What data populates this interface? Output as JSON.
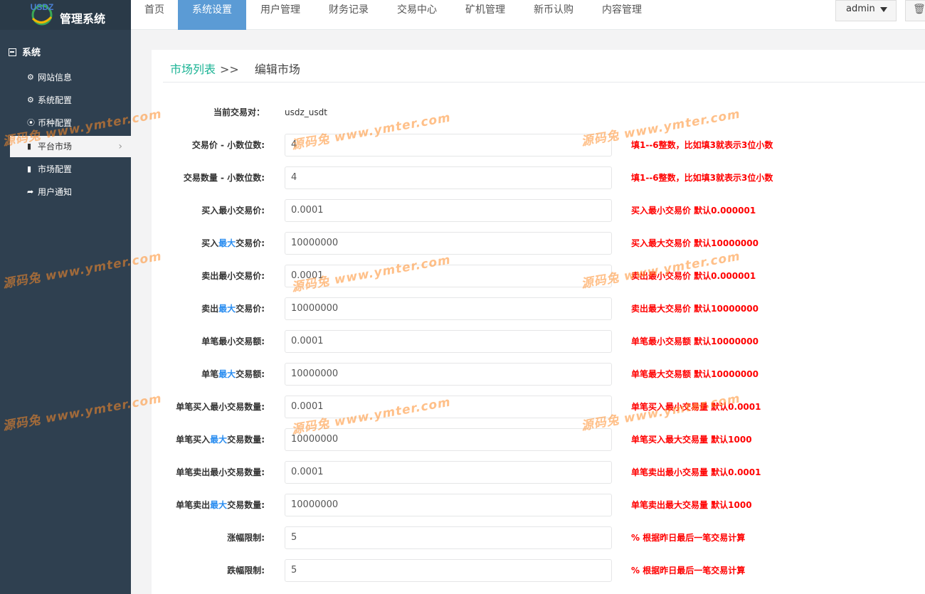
{
  "app": {
    "logo_text": "USDZ",
    "title": "管理系统"
  },
  "topnav": {
    "tabs": [
      {
        "label": "首页"
      },
      {
        "label": "系统设置"
      },
      {
        "label": "用户管理"
      },
      {
        "label": "财务记录"
      },
      {
        "label": "交易中心"
      },
      {
        "label": "矿机管理"
      },
      {
        "label": "新币认购"
      },
      {
        "label": "内容管理"
      }
    ],
    "active_tab": "系统设置",
    "user": "admin"
  },
  "sidebar": {
    "group": "系统",
    "items": [
      {
        "label": "网站信息",
        "icon": "gear-icon"
      },
      {
        "label": "系统配置",
        "icon": "gear-icon"
      },
      {
        "label": "币种配置",
        "icon": "circle-dot-icon"
      },
      {
        "label": "平台市场",
        "icon": "bar-chart-icon"
      },
      {
        "label": "市场配置",
        "icon": "bar-chart-icon"
      },
      {
        "label": "用户通知",
        "icon": "share-icon"
      }
    ],
    "active_item": "平台市场"
  },
  "breadcrumb": {
    "parent": "市场列表",
    "separator": ">>",
    "current": "编辑市场"
  },
  "form": {
    "pair_label": "当前交易对：",
    "pair_value": "usdz_usdt",
    "fields": [
      {
        "label_pre": "交易价 - 小数位数:",
        "label_hl": "",
        "label_post": "",
        "value": "4",
        "hint": "填1--6整数，比如填3就表示3位小数"
      },
      {
        "label_pre": "交易数量 - 小数位数:",
        "label_hl": "",
        "label_post": "",
        "value": "4",
        "hint": "填1--6整数，比如填3就表示3位小数"
      },
      {
        "label_pre": "买入最小交易价:",
        "label_hl": "",
        "label_post": "",
        "value": "0.0001",
        "hint": "买入最小交易价 默认0.000001"
      },
      {
        "label_pre": "买入",
        "label_hl": "最大",
        "label_post": "交易价:",
        "value": "10000000",
        "hint": "买入最大交易价 默认10000000"
      },
      {
        "label_pre": "卖出最小交易价:",
        "label_hl": "",
        "label_post": "",
        "value": "0.0001",
        "hint": "卖出最小交易价 默认0.000001"
      },
      {
        "label_pre": "卖出",
        "label_hl": "最大",
        "label_post": "交易价:",
        "value": "10000000",
        "hint": "卖出最大交易价 默认10000000"
      },
      {
        "label_pre": "单笔最小交易额:",
        "label_hl": "",
        "label_post": "",
        "value": "0.0001",
        "hint": "单笔最小交易额 默认10000000"
      },
      {
        "label_pre": "单笔",
        "label_hl": "最大",
        "label_post": "交易额:",
        "value": "10000000",
        "hint": "单笔最大交易额 默认10000000"
      },
      {
        "label_pre": "单笔买入最小交易数量:",
        "label_hl": "",
        "label_post": "",
        "value": "0.0001",
        "hint": "单笔买入最小交易量 默认0.0001"
      },
      {
        "label_pre": "单笔买入",
        "label_hl": "最大",
        "label_post": "交易数量:",
        "value": "10000000",
        "hint": "单笔买入最大交易量 默认1000"
      },
      {
        "label_pre": "单笔卖出最小交易数量:",
        "label_hl": "",
        "label_post": "",
        "value": "0.0001",
        "hint": "单笔卖出最小交易量 默认0.0001"
      },
      {
        "label_pre": "单笔卖出",
        "label_hl": "最大",
        "label_post": "交易数量:",
        "value": "10000000",
        "hint": "单笔卖出最大交易量 默认1000"
      },
      {
        "label_pre": "涨幅限制:",
        "label_hl": "",
        "label_post": "",
        "value": "5",
        "hint": "% 根据昨日最后一笔交易计算"
      },
      {
        "label_pre": "跌幅限制:",
        "label_hl": "",
        "label_post": "",
        "value": "5",
        "hint": "% 根据昨日最后一笔交易计算"
      }
    ]
  },
  "watermark": {
    "text": "源码兔 www.ymter.com"
  },
  "colors": {
    "sidebar": "#2f4050",
    "accent": "#5b9bd5",
    "link": "#1ab394",
    "hint": "#ff0000",
    "highlight": "#2a8df0"
  }
}
